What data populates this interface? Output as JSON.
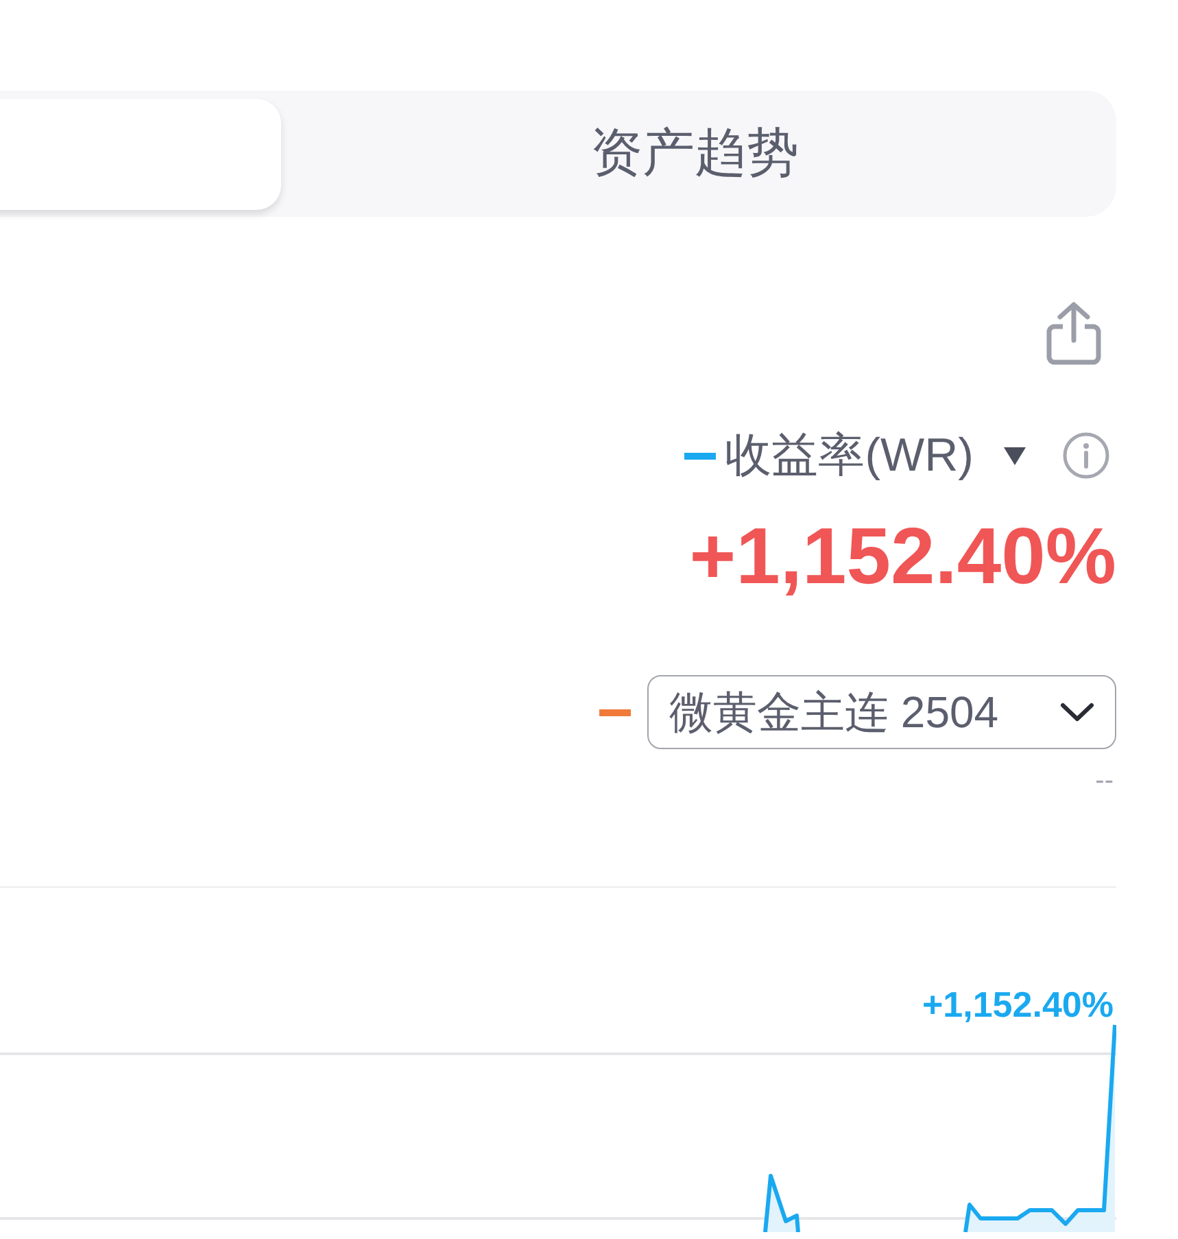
{
  "tabs": [
    {
      "selected": true
    },
    {
      "label": "资产趋势",
      "selected": false
    }
  ],
  "legend": [
    {
      "kind": "metric",
      "label": "收益率(WR)",
      "color": "#1aa9f0",
      "value": "+1,152.40%"
    },
    {
      "kind": "benchmark",
      "label": "微黄金主连 2504",
      "color": "#f07a3a",
      "value": "--"
    }
  ],
  "chart": {
    "end_label": "+1,152.40%"
  }
}
